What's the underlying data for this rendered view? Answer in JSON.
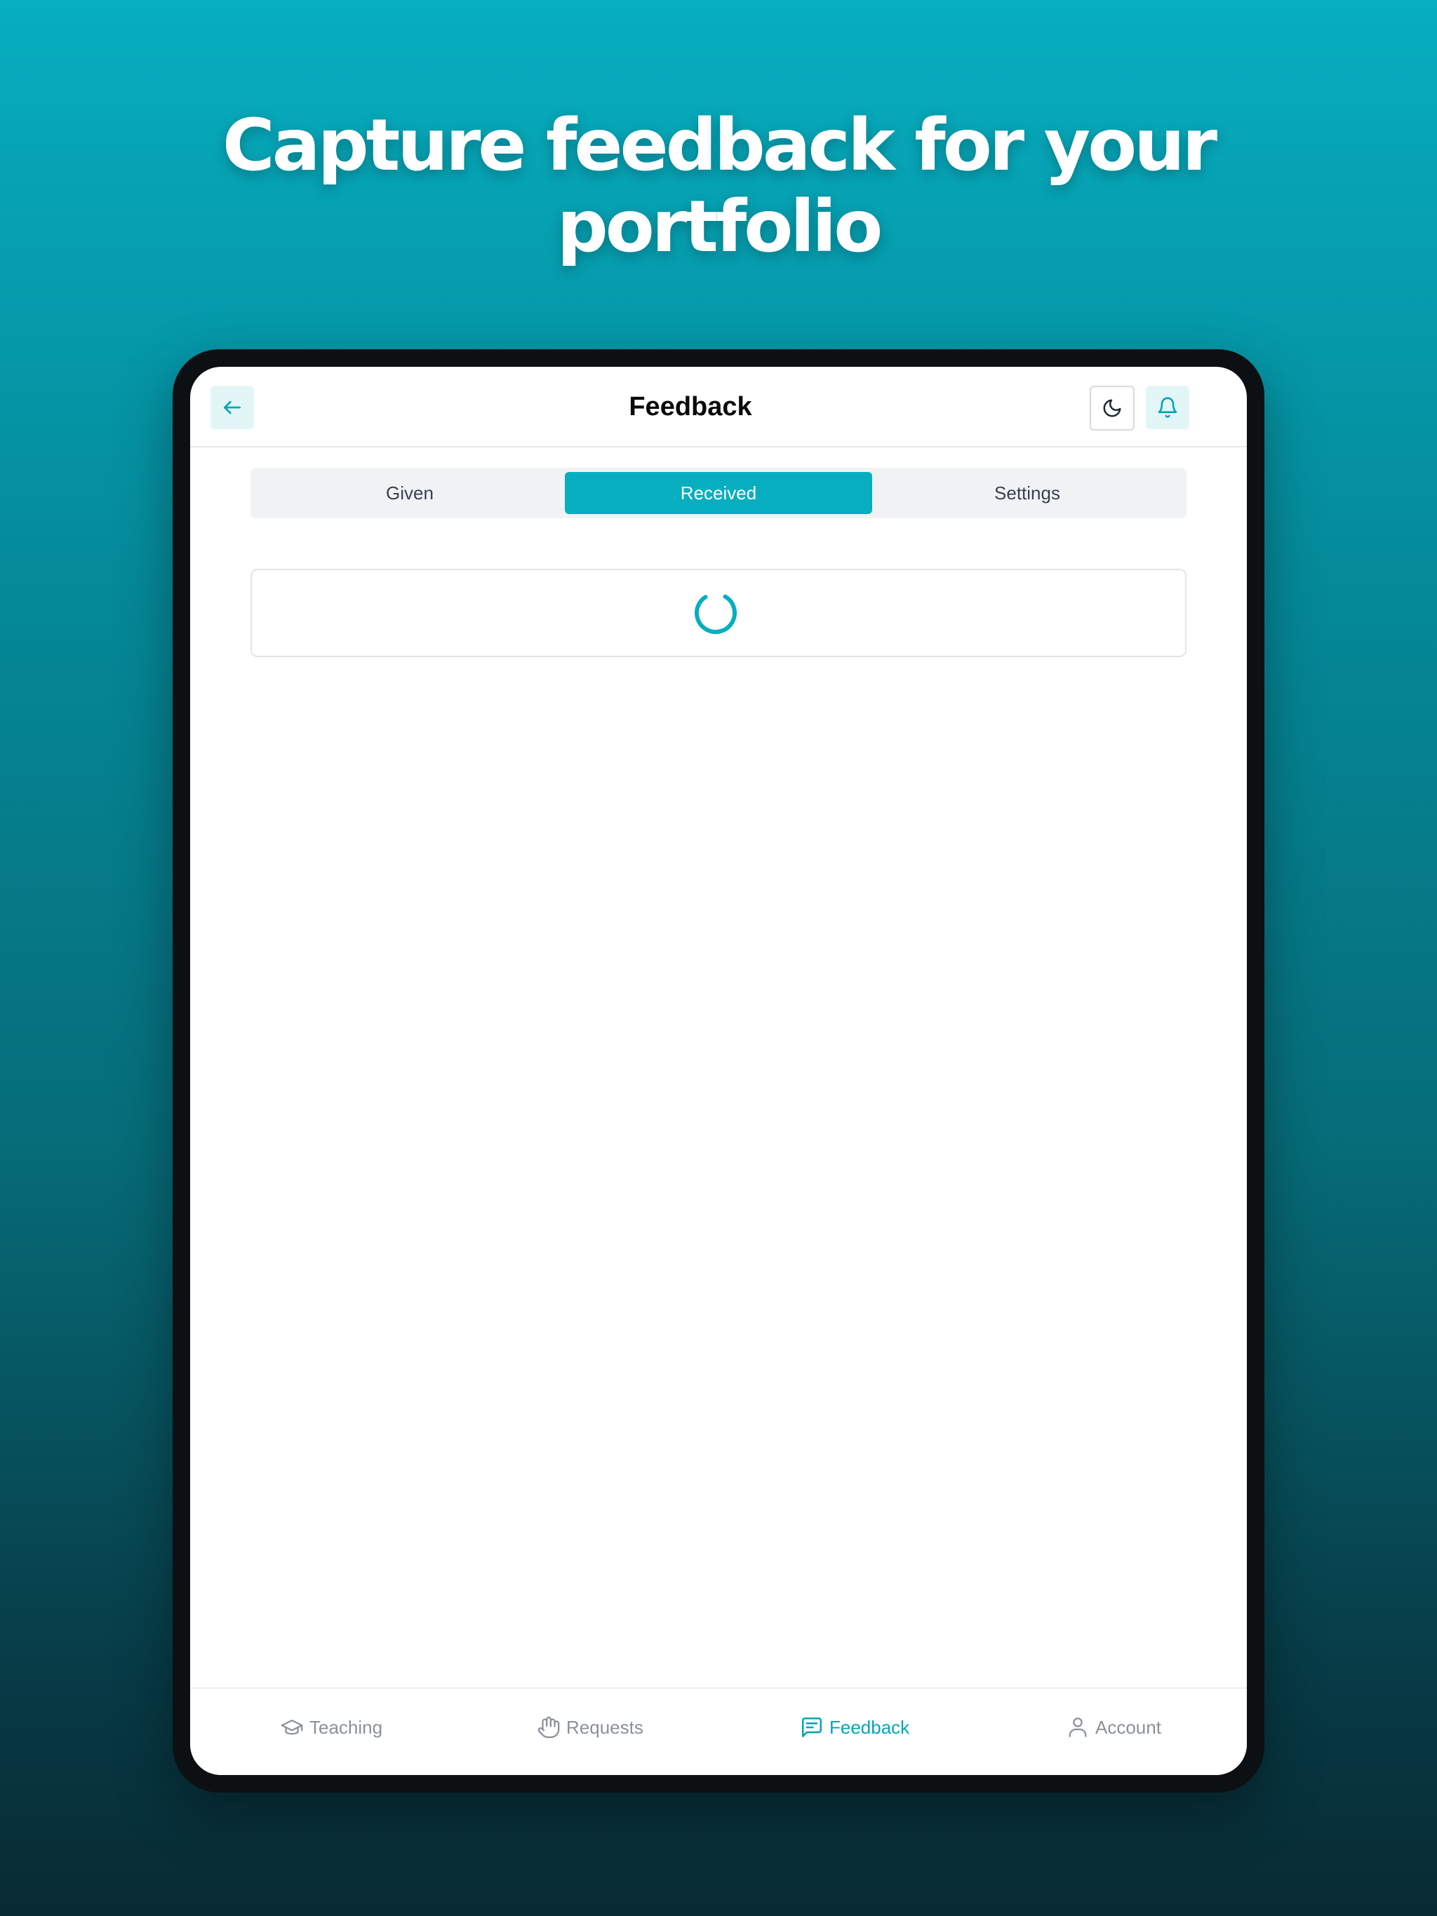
{
  "headline": {
    "line1": "Capture feedback for your",
    "line2": "portfolio"
  },
  "header": {
    "title": "Feedback",
    "back_icon": "arrow-left-icon",
    "theme_icon": "moon-icon",
    "notifications_icon": "bell-icon"
  },
  "tabs": [
    {
      "label": "Given",
      "active": false
    },
    {
      "label": "Received",
      "active": true
    },
    {
      "label": "Settings",
      "active": false
    }
  ],
  "loading": {
    "icon": "spinner-icon"
  },
  "bottom_nav": [
    {
      "label": "Teaching",
      "icon": "graduation-cap-icon",
      "active": false
    },
    {
      "label": "Requests",
      "icon": "hand-icon",
      "active": false
    },
    {
      "label": "Feedback",
      "icon": "message-square-icon",
      "active": true
    },
    {
      "label": "Account",
      "icon": "user-icon",
      "active": false
    }
  ],
  "colors": {
    "accent": "#06aec0",
    "accent_light": "#e2f6f8",
    "inactive_text": "#8b9197",
    "background_top": "#06aec0",
    "background_bottom": "#082a33"
  }
}
